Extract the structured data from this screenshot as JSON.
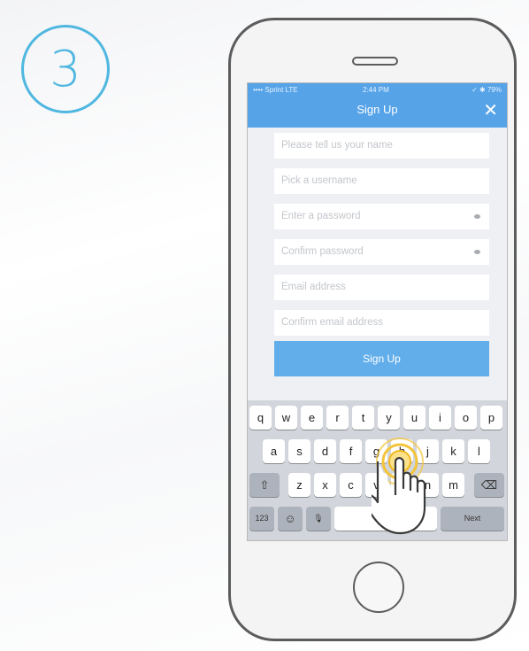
{
  "step_number": "3",
  "status_bar": {
    "carrier": "•••• Sprint LTE",
    "time": "2:44 PM",
    "battery": "✓ ✱ 79%"
  },
  "navbar": {
    "title": "Sign Up",
    "close_glyph": "✕"
  },
  "form": {
    "fields": [
      {
        "placeholder": "Please tell us your name"
      },
      {
        "placeholder": "Pick a username"
      },
      {
        "placeholder": "Enter a password"
      },
      {
        "placeholder": "Confirm password"
      },
      {
        "placeholder": "Email address"
      },
      {
        "placeholder": "Confirm email address"
      }
    ],
    "submit_label": "Sign Up"
  },
  "keyboard": {
    "row1": [
      "q",
      "w",
      "e",
      "r",
      "t",
      "y",
      "u",
      "i",
      "o",
      "p"
    ],
    "row2": [
      "a",
      "s",
      "d",
      "f",
      "g",
      "h",
      "j",
      "k",
      "l"
    ],
    "row3": [
      "z",
      "x",
      "c",
      "v",
      "b",
      "n",
      "m"
    ],
    "shift": "⇧",
    "backspace": "⌫",
    "numbers": "123",
    "emoji": "☺",
    "mic": "🎙",
    "space": "space",
    "next": "Next"
  },
  "colors": {
    "accent": "#4fb7e0",
    "navbar": "#56a3e8",
    "button": "#62aeeb",
    "tap_ring": "#f3c53a"
  }
}
